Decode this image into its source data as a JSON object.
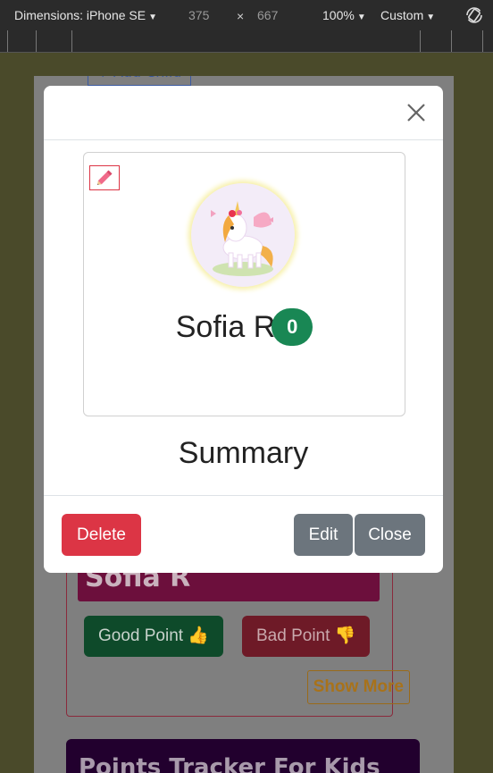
{
  "devtools": {
    "device_label": "Dimensions: iPhone SE",
    "width": "375",
    "times": "×",
    "height": "667",
    "zoom": "100%",
    "throttle": "Custom"
  },
  "background_page": {
    "add_child_label": "+ Add Child",
    "child_name": "Sofia R",
    "good_point_label": "Good Point 👍",
    "bad_point_label": "Bad Point 👎",
    "show_more_label": "Show More",
    "tracker_title": "Points Tracker For Kids"
  },
  "modal": {
    "child_name": "Sofia R",
    "points": "0",
    "summary_heading": "Summary",
    "delete_label": "Delete",
    "edit_label": "Edit",
    "close_label": "Close"
  },
  "colors": {
    "danger": "#dc3545",
    "secondary": "#6c757d",
    "success": "#198754"
  }
}
